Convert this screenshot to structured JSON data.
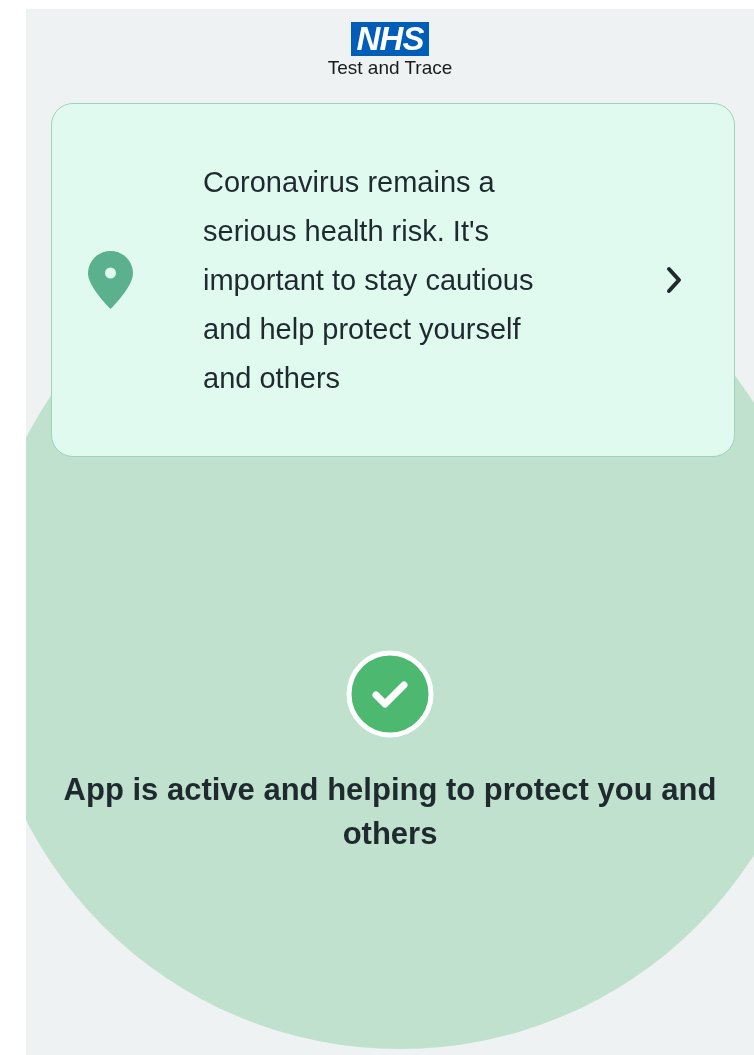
{
  "header": {
    "logo": "NHS",
    "subtitle": "Test and Trace"
  },
  "info_card": {
    "text": "Coronavirus remains a serious health risk. It's important to stay cautious and help protect yourself and others"
  },
  "status": {
    "active": true,
    "text": "App is active and helping to protect you and others"
  }
}
